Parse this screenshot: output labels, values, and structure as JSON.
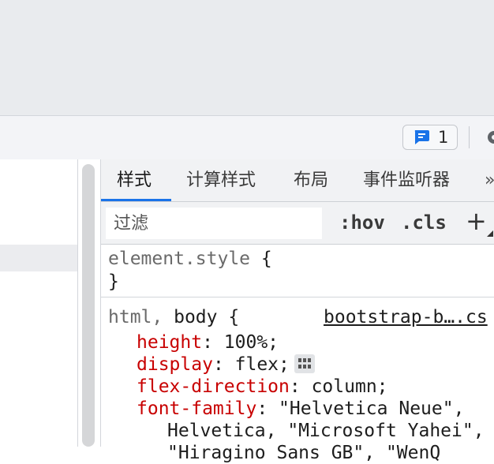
{
  "toolbar": {
    "issues_count": "1"
  },
  "tabs": [
    {
      "label": "样式",
      "active": true
    },
    {
      "label": "计算样式",
      "active": false
    },
    {
      "label": "布局",
      "active": false
    },
    {
      "label": "事件监听器",
      "active": false
    },
    {
      "label": "»",
      "active": false
    }
  ],
  "filter": {
    "placeholder": "过滤",
    "hov_label": ":hov",
    "cls_label": ".cls",
    "add_label": "+"
  },
  "element_style": {
    "selector": "element.style",
    "open": "{",
    "close": "}"
  },
  "rule": {
    "selector_gray": "html,",
    "selector_dark": "body",
    "open": "{",
    "source": "bootstrap-b….cs",
    "declarations": [
      {
        "prop": "height",
        "value": "100%;"
      },
      {
        "prop": "display",
        "value": "flex;"
      },
      {
        "prop": "flex-direction",
        "value": "column;"
      },
      {
        "prop": "font-family",
        "value": "\"Helvetica Neue\","
      }
    ],
    "continuation": "Helvetica, \"Microsoft Yahei\",",
    "continuation_2": "\"Hiragino Sans GB\", \"WenQ"
  },
  "colors": {
    "accent": "#1a73e8",
    "property": "#c80000"
  }
}
